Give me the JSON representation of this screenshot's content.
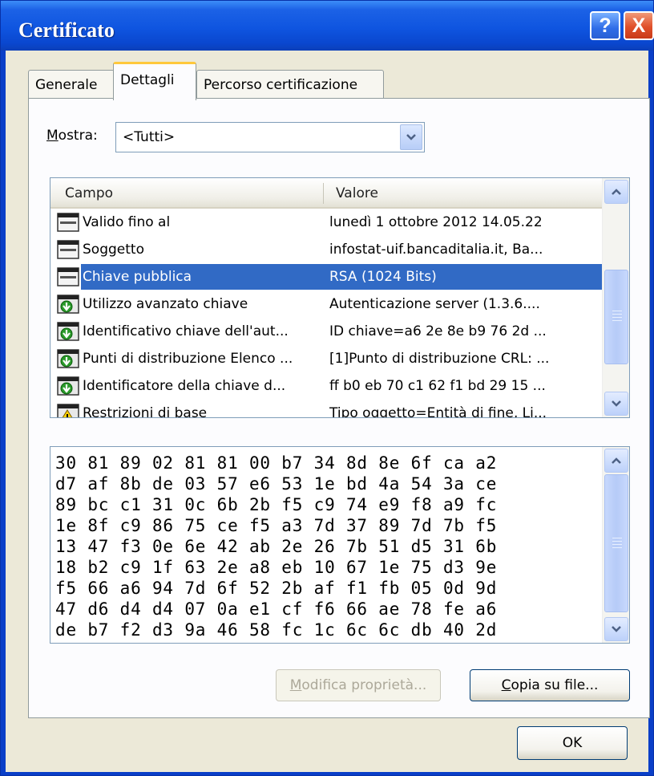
{
  "window": {
    "title": "Certificato",
    "help_label": "?",
    "close_label": "X"
  },
  "tabs": [
    {
      "label": "Generale",
      "active": false
    },
    {
      "label": "Dettagli",
      "active": true
    },
    {
      "label": "Percorso certificazione",
      "active": false
    }
  ],
  "mostra": {
    "label_underlined": "M",
    "label_rest": "ostra:",
    "value": "<Tutti>"
  },
  "fields": {
    "columns": [
      "Campo",
      "Valore"
    ],
    "rows": [
      {
        "campo": "Valido fino al",
        "valore": "lunedì 1 ottobre 2012 14.05.22",
        "icon": "document-field-icon"
      },
      {
        "campo": "Soggetto",
        "valore": "infostat-uif.bancaditalia.it, Ba...",
        "icon": "document-field-icon"
      },
      {
        "campo": "Chiave pubblica",
        "valore": "RSA (1024 Bits)",
        "icon": "document-field-icon",
        "selected": true
      },
      {
        "campo": "Utilizzo avanzato chiave",
        "valore": "Autenticazione server (1.3.6....",
        "icon": "extension-icon"
      },
      {
        "campo": "Identificativo chiave dell'aut...",
        "valore": "ID chiave=a6 2e 8e b9 76 2d ...",
        "icon": "extension-icon"
      },
      {
        "campo": "Punti di distribuzione Elenco ...",
        "valore": "[1]Punto di distribuzione CRL: ...",
        "icon": "extension-icon"
      },
      {
        "campo": "Identificatore della chiave d...",
        "valore": "ff b0 eb 70 c1 62 f1 bd 29 15 ...",
        "icon": "extension-icon"
      },
      {
        "campo": "Restrizioni di base",
        "valore": "Tipo oggetto=Entità di fine, Li...",
        "icon": "critical-extension-icon"
      }
    ]
  },
  "hex_lines": [
    "30 81 89 02 81 81 00 b7 34 8d 8e 6f ca a2",
    "d7 af 8b de 03 57 e6 53 1e bd 4a 54 3a ce",
    "89 bc c1 31 0c 6b 2b f5 c9 74 e9 f8 a9 fc",
    "1e 8f c9 86 75 ce f5 a3 7d 37 89 7d 7b f5",
    "13 47 f3 0e 6e 42 ab 2e 26 7b 51 d5 31 6b",
    "18 b2 c9 1f 63 2e a8 eb 10 67 1e 75 d3 9e",
    "f5 66 a6 94 7d 6f 52 2b af f1 fb 05 0d 9d",
    "47 d6 d4 d4 07 0a e1 cf f6 66 ae 78 fe a6",
    "de b7 f2 d3 9a 46 58 fc 1c 6c 6c db 40 2d"
  ],
  "buttons": {
    "modifica_underlined": "M",
    "modifica_rest": "odifica proprietà...",
    "copia_underlined": "C",
    "copia_rest": "opia su file...",
    "ok": "OK"
  },
  "colors": {
    "title_bar": "#0a47cf",
    "selection": "#316ac5",
    "dialog_bg": "#ece9d8",
    "active_tab_accent": "#ffc83c"
  }
}
